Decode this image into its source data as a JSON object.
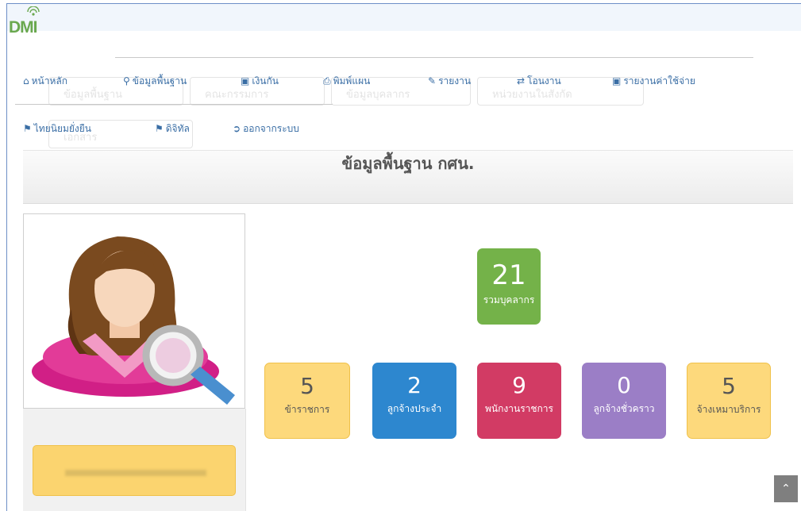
{
  "logo": {
    "text": "DMI"
  },
  "ghost_buttons": [
    {
      "label": "ข้อมูลพื้นฐาน"
    },
    {
      "label": "คณะกรรมการ"
    },
    {
      "label": "ข้อมูลบุคลากร"
    },
    {
      "label": "หน่วยงานในสังกัด"
    },
    {
      "label": "เอกสาร"
    }
  ],
  "menu": {
    "home": {
      "icon": "home-icon",
      "label": "หน้าหลัก"
    },
    "basic_info": {
      "icon": "map-marker-icon",
      "label": "ข้อมูลพื้นฐาน"
    },
    "insurance": {
      "icon": "money-icon",
      "label": "เงินกัน"
    },
    "print_plan": {
      "icon": "print-icon",
      "label": "พิมพ์แผน"
    },
    "report": {
      "icon": "pencil-icon",
      "label": "รายงาน"
    },
    "transfer": {
      "icon": "exchange-icon",
      "label": "โอนงาน"
    },
    "expense_report": {
      "icon": "money-icon",
      "label": "รายงานค่าใช้จ่าย"
    },
    "thai_niyom": {
      "icon": "flag-icon",
      "label": "ไทยนิยมยั่งยืน"
    },
    "digital": {
      "icon": "flag-icon",
      "label": "ดิจิทัล"
    },
    "logout": {
      "icon": "sign-out-icon",
      "label": "ออกจากระบบ"
    }
  },
  "panel": {
    "title": "ข้อมูลพื้นฐาน กศน."
  },
  "profile": {
    "image": "female-user-search-avatar"
  },
  "stats": {
    "total": {
      "value": "21",
      "label": "รวมบุคลากร",
      "color": "#74b249"
    },
    "civil_servant": {
      "value": "5",
      "label": "ข้าราชการ",
      "color": "#fdd97c"
    },
    "permanent_employee": {
      "value": "2",
      "label": "ลูกจ้างประจำ",
      "color": "#2d87cf"
    },
    "government_employee": {
      "value": "9",
      "label": "พนักงานราชการ",
      "color": "#d23b64"
    },
    "temporary_employee": {
      "value": "0",
      "label": "ลูกจ้างชั่วคราว",
      "color": "#9b7ec6"
    },
    "contract_service": {
      "value": "5",
      "label": "จ้างเหมาบริการ",
      "color": "#fdd97c"
    }
  },
  "scroll_top": {
    "icon": "double-chevron-up-icon"
  }
}
